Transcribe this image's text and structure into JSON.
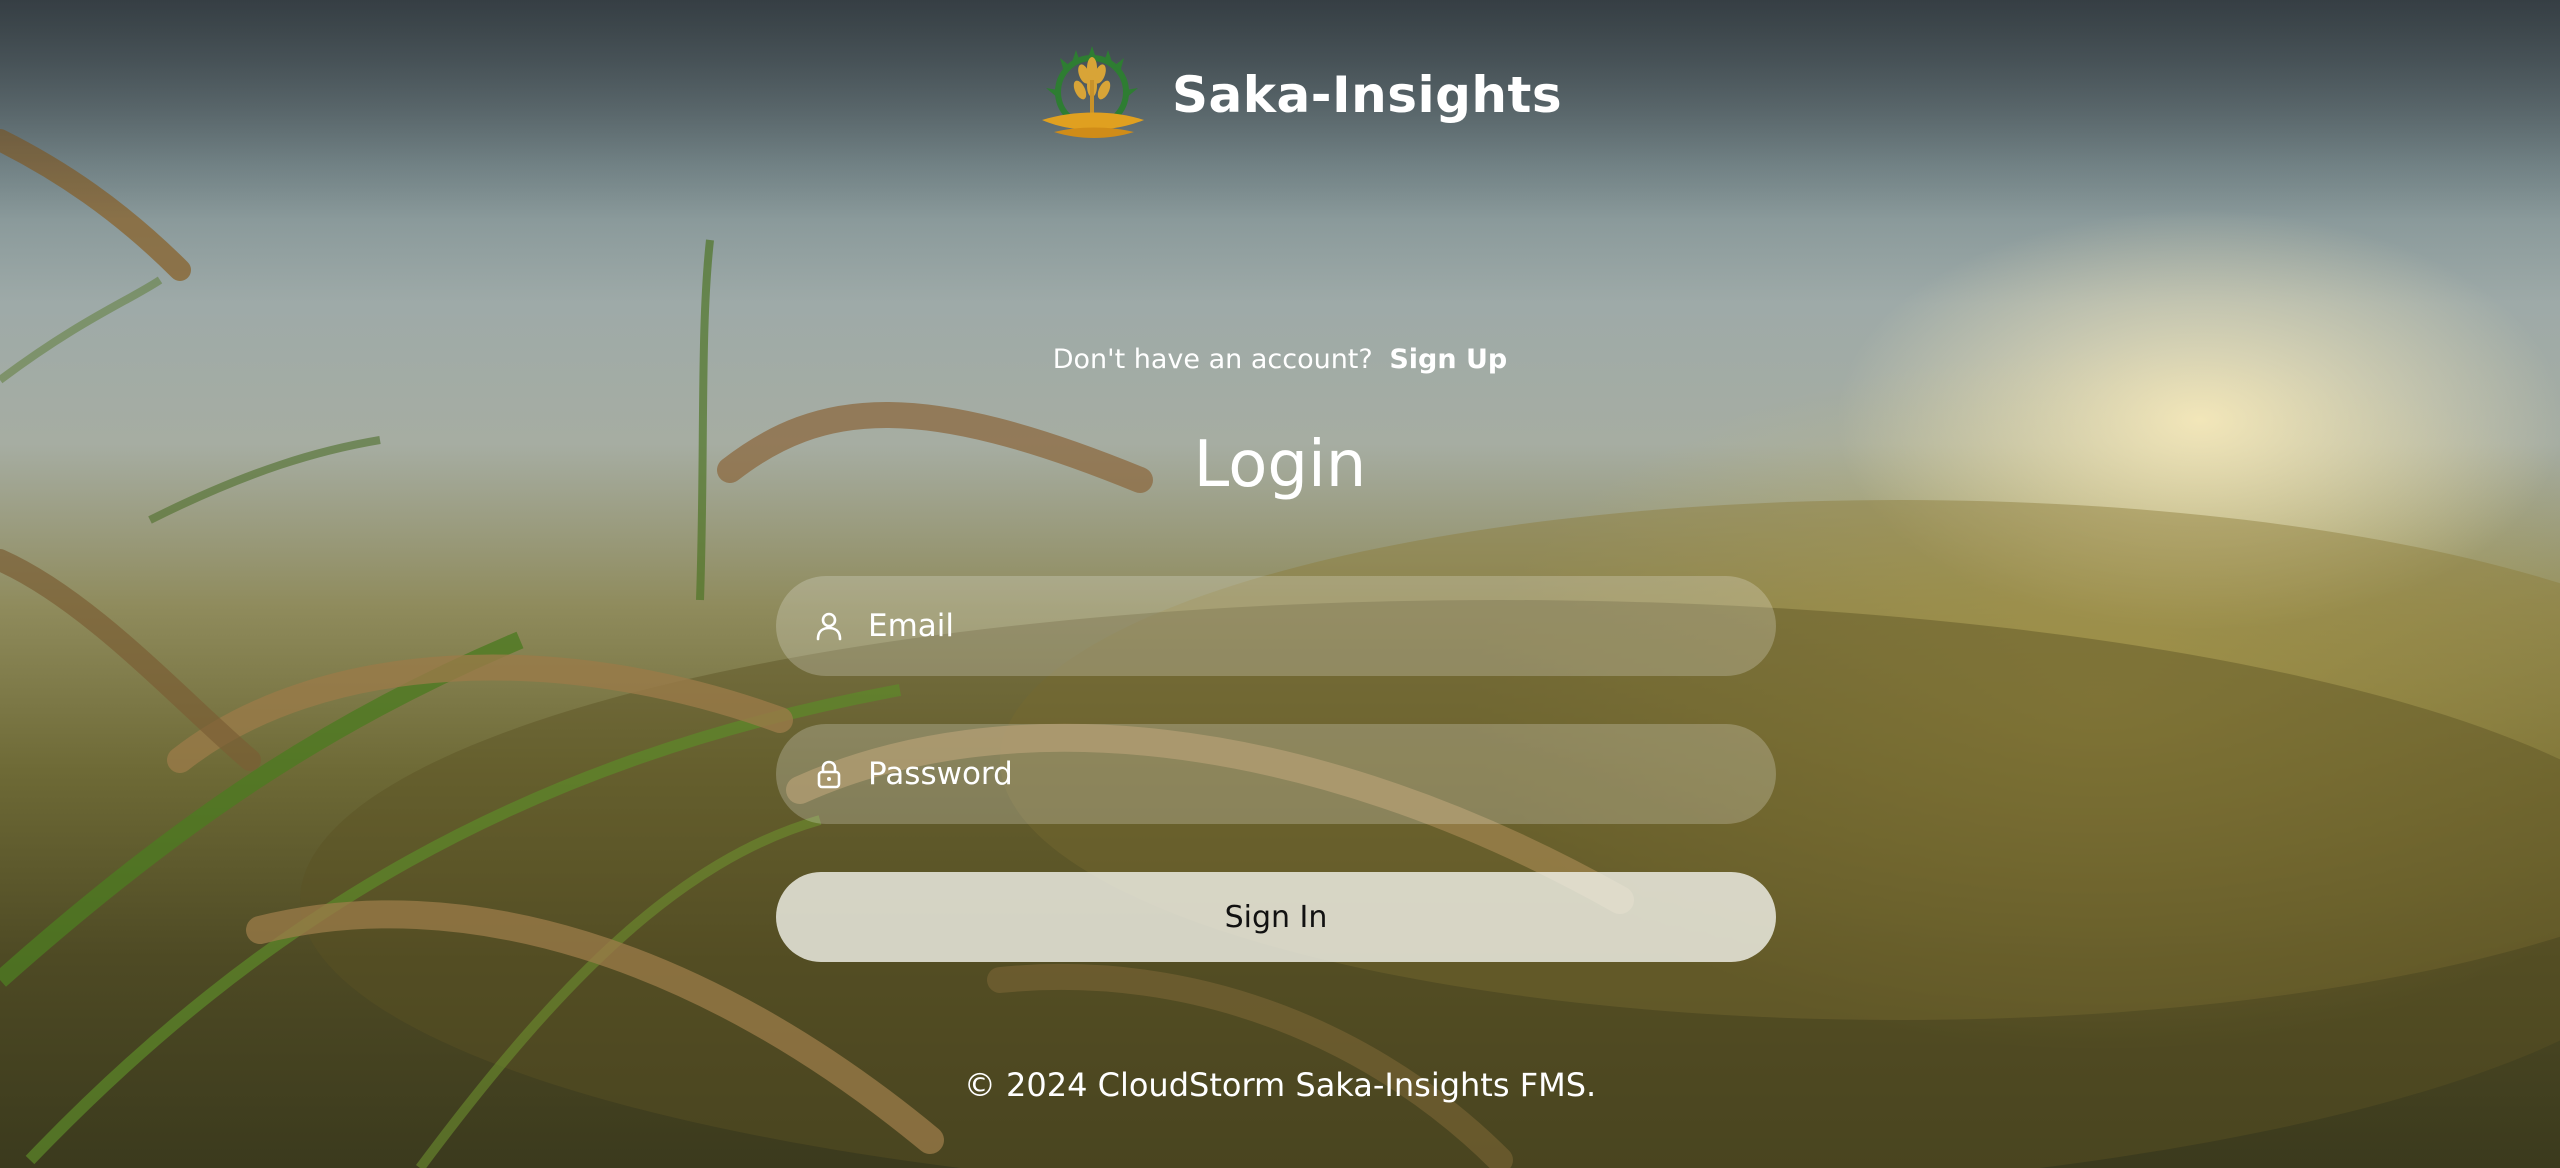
{
  "brand": {
    "name": "Saka-Insights",
    "logo_icon": "wheat-sun-logo-icon"
  },
  "auth": {
    "signup_prompt": "Don't have an account?",
    "signup_link": "Sign Up",
    "title": "Login",
    "email_placeholder": "Email",
    "email_icon": "user-icon",
    "password_placeholder": "Password",
    "password_icon": "lock-icon",
    "signin_label": "Sign In"
  },
  "footer": {
    "text": "© 2024 CloudStorm Saka-Insights FMS."
  },
  "colors": {
    "text": "#ffffff",
    "field_bg": "rgba(255,255,255,0.22)",
    "button_bg": "#f0f0e8",
    "logo_green": "#2e7d32",
    "logo_gold": "#e0a020"
  }
}
